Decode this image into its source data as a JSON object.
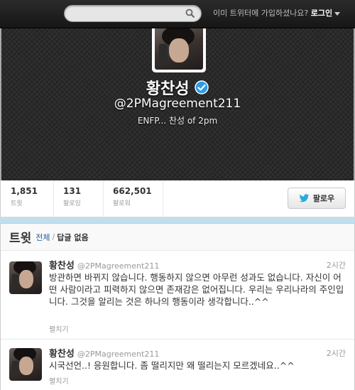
{
  "topbar": {
    "search_placeholder": "",
    "login_prompt": "이미 트위터에 가입하셨나요?",
    "login_link": "로그인"
  },
  "profile": {
    "name": "황찬성",
    "handle": "@2PMagreement211",
    "bio": "ENFP... 찬성 of 2pm",
    "verified": true
  },
  "stats": [
    {
      "value": "1,851",
      "label": "트윗"
    },
    {
      "value": "131",
      "label": "팔로잉"
    },
    {
      "value": "662,501",
      "label": "팔로워"
    }
  ],
  "follow_button": {
    "label": "팔로우"
  },
  "tweets_panel": {
    "title": "트윗",
    "tab_all": "전체",
    "tab_separator": "/",
    "tab_no_replies": "답글 없음"
  },
  "tweets": [
    {
      "name": "황찬성",
      "handle": "@2PMagreement211",
      "time": "2시간",
      "text": "방관하면 바뀌지 않습니다. 행동하지 않으면 아무런 성과도 없습니다. 자신이 어떤 사람이라고 피력하지 않으면 존재감은 없어집니다. 우리는 우리나라의 주인입니다. 그것을 알리는 것은 하나의 행동이라 생각합니다..^^",
      "expand": "펼치기"
    },
    {
      "name": "황찬성",
      "handle": "@2PMagreement211",
      "time": "2시간",
      "text": "시국선언..! 응원합니다. 좀 떨리지만 왜 떨리는지 모르겠네요..^^",
      "expand": "펼치기"
    }
  ],
  "colors": {
    "link": "#1f5fa8",
    "verified": "#2b9be6",
    "bird": "#2aa9e0",
    "background": "#c0deed"
  }
}
